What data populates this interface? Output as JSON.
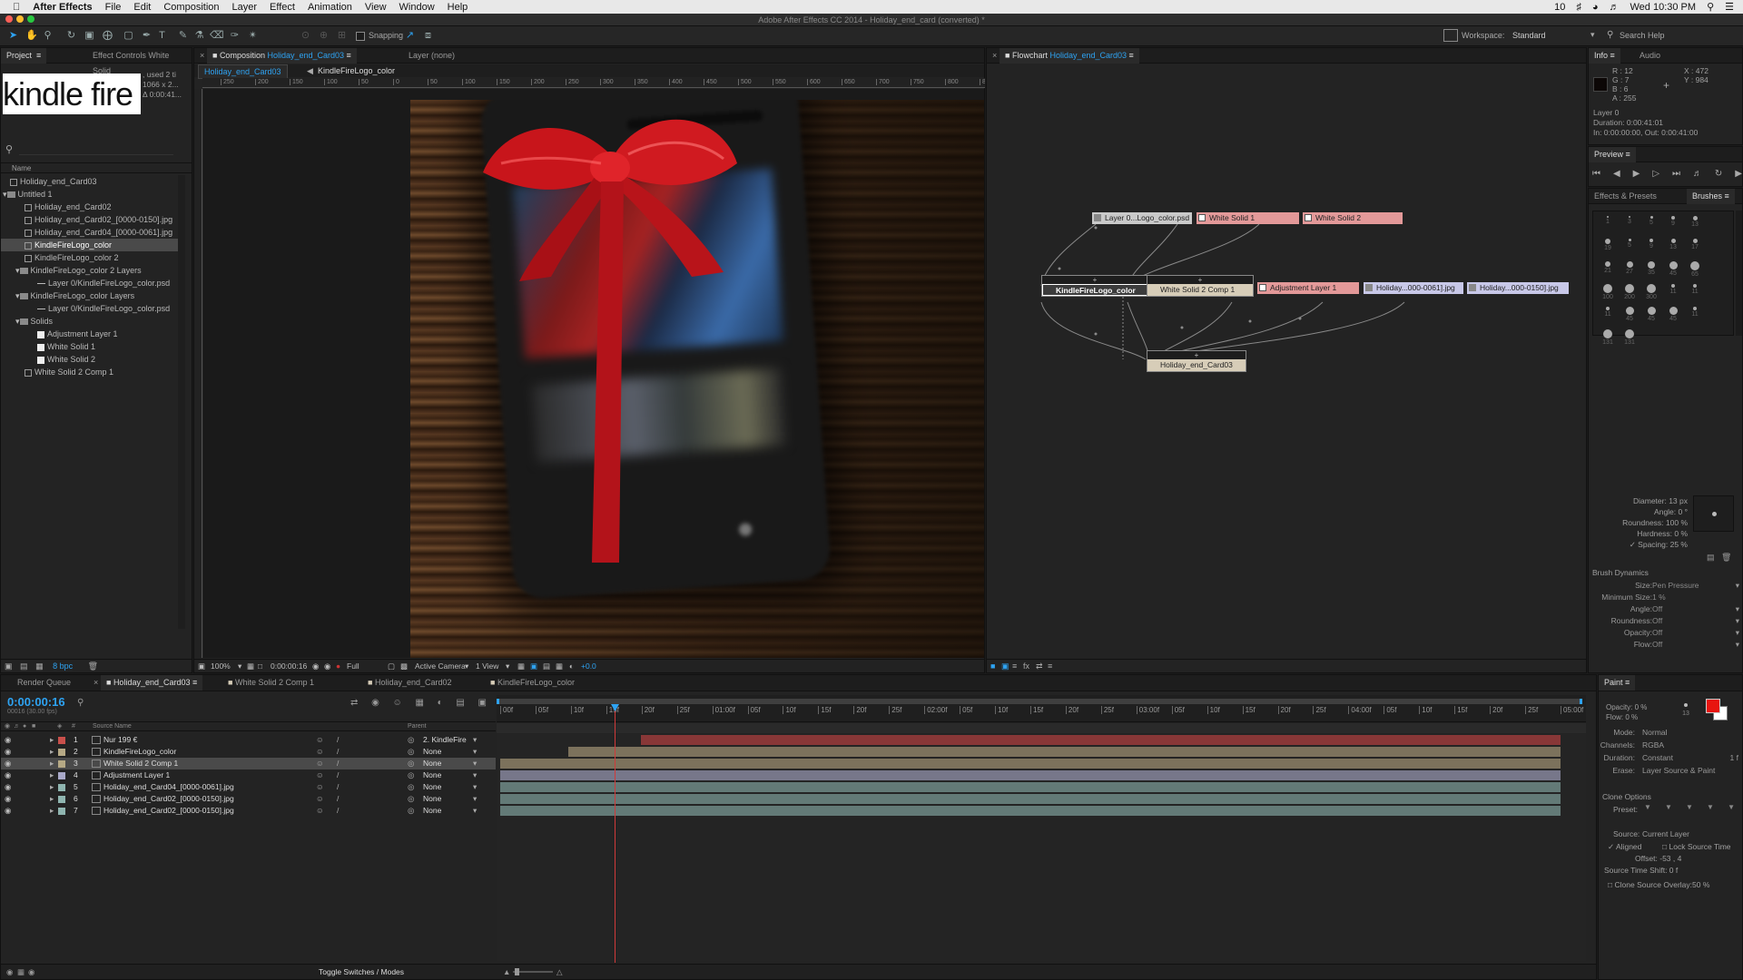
{
  "mac_menu": {
    "app": "After Effects",
    "items": [
      "File",
      "Edit",
      "Composition",
      "Layer",
      "Effect",
      "Animation",
      "View",
      "Window",
      "Help"
    ],
    "clock": "Wed 10:30 PM",
    "badge": "10"
  },
  "window_title": "Adobe After Effects CC 2014 - Holiday_end_card (converted) *",
  "toolbar": {
    "snapping": "Snapping",
    "workspace_label": "Workspace:",
    "workspace_value": "Standard",
    "search_help": "Search Help"
  },
  "project": {
    "tab_project": "Project",
    "tab_effect_controls": "Effect Controls White Solid",
    "thumbnail_text": "kindle fire",
    "thumb_info": [
      ", used 2 ti",
      "1066 x 2...",
      "Δ 0:00:41..."
    ],
    "col_name": "Name",
    "items": [
      {
        "label": "Holiday_end_Card03",
        "kind": "comp"
      },
      {
        "label": "Untitled 1",
        "kind": "folder"
      },
      {
        "label": "Holiday_end_Card02",
        "kind": "comp"
      },
      {
        "label": "Holiday_end_Card02_[0000-0150].jpg",
        "kind": "file"
      },
      {
        "label": "Holiday_end_Card04_[0000-0061].jpg",
        "kind": "file"
      },
      {
        "label": "KindleFireLogo_color",
        "kind": "comp"
      },
      {
        "label": "KindleFireLogo_color 2",
        "kind": "comp"
      },
      {
        "label": "KindleFireLogo_color 2 Layers",
        "kind": "folder"
      },
      {
        "label": "Layer 0/KindleFireLogo_color.psd",
        "kind": "file"
      },
      {
        "label": "KindleFireLogo_color Layers",
        "kind": "folder"
      },
      {
        "label": "Layer 0/KindleFireLogo_color.psd",
        "kind": "file"
      },
      {
        "label": "Solids",
        "kind": "folder"
      },
      {
        "label": "Adjustment Layer 1",
        "kind": "solid"
      },
      {
        "label": "White Solid 1",
        "kind": "solid"
      },
      {
        "label": "White Solid 2",
        "kind": "solid"
      },
      {
        "label": "White Solid 2 Comp 1",
        "kind": "comp"
      }
    ],
    "bpc": "8 bpc"
  },
  "composition": {
    "tab_label": "Composition",
    "tab_comp": "Holiday_end_Card03",
    "tab_layer": "Layer (none)",
    "sub_tab_1": "Holiday_end_Card03",
    "sub_tab_2": "KindleFireLogo_color",
    "ruler": [
      "250",
      "200",
      "150",
      "100",
      "50",
      "0",
      "50",
      "100",
      "150",
      "200",
      "250",
      "300",
      "350",
      "400",
      "450",
      "500",
      "550",
      "600",
      "650",
      "700",
      "750",
      "800",
      "85"
    ],
    "footer": {
      "zoom": "100%",
      "timecode": "0:00:00:16",
      "resolution": "Full",
      "camera": "Active Camera",
      "views": "1 View",
      "exposure": "+0.0"
    }
  },
  "flowchart": {
    "tab_label": "Flowchart",
    "tab_comp": "Holiday_end_Card03",
    "nodes": {
      "layer0": "Layer 0...Logo_color.psd",
      "ws1": "White Solid 1",
      "ws2": "White Solid 2",
      "kindle": "KindleFireLogo_color",
      "wsc": "White Solid 2 Comp 1",
      "adj": "Adjustment Layer 1",
      "h1": "Holiday...000-0061].jpg",
      "h2": "Holiday...000-0150].jpg",
      "out": "Holiday_end_Card03"
    }
  },
  "info": {
    "tab_info": "Info",
    "tab_audio": "Audio",
    "r": "R : 12",
    "g": "G : 7",
    "b": "B : 6",
    "a": "A : 255",
    "x": "X : 472",
    "y": "Y : 984",
    "layer": "Layer 0",
    "duration": "Duration: 0:00:41:01",
    "inout": "In: 0:00:00:00, Out: 0:00:41:00"
  },
  "preview": {
    "title": "Preview"
  },
  "brushes": {
    "tab_effects": "Effects & Presets",
    "tab_brushes": "Brushes",
    "sizes": [
      "1",
      "3",
      "5",
      "9",
      "13",
      "19",
      "5",
      "9",
      "13",
      "17",
      "21",
      "27",
      "35",
      "45",
      "65",
      "100",
      "200",
      "300",
      "11",
      "11",
      "11",
      "45",
      "45",
      "45",
      "11",
      "131",
      "131"
    ],
    "diameter": "Diameter: 13 px",
    "angle": "Angle: 0 °",
    "roundness": "Roundness: 100 %",
    "hardness": "Hardness: 0 %",
    "spacing": "Spacing: 25 %",
    "dynamics_title": "Brush Dynamics",
    "dynamics": [
      {
        "label": "Size:",
        "value": "Pen Pressure"
      },
      {
        "label": "Minimum Size:",
        "value": "1 %"
      },
      {
        "label": "Angle:",
        "value": "Off"
      },
      {
        "label": "Roundness:",
        "value": "Off"
      },
      {
        "label": "Opacity:",
        "value": "Off"
      },
      {
        "label": "Flow:",
        "value": "Off"
      }
    ]
  },
  "paint": {
    "title": "Paint",
    "opacity": "Opacity: 0 %",
    "flow": "Flow: 0 %",
    "brush_size": "13",
    "mode_label": "Mode:",
    "mode": "Normal",
    "channels_label": "Channels:",
    "channels": "RGBA",
    "duration_label": "Duration:",
    "duration": "Constant",
    "duration_frames": "1 f",
    "erase_label": "Erase:",
    "erase": "Layer Source & Paint",
    "clone_options": "Clone Options",
    "preset_label": "Preset:",
    "source_label": "Source:",
    "source": "Current Layer",
    "aligned": "Aligned",
    "lock_source": "Lock Source Time",
    "offset": "Offset: -53 ,     4",
    "source_time_shift": "Source Time Shift: 0 f",
    "clone_overlay": "Clone Source Overlay:",
    "clone_overlay_pct": "50 %",
    "fg_color": "#e8150f",
    "bg_color": "#ffffff"
  },
  "timeline": {
    "tabs": [
      "Render Queue",
      "Holiday_end_Card03",
      "White Solid 2 Comp 1",
      "Holiday_end_Card02",
      "KindleFireLogo_color"
    ],
    "timecode": "0:00:00:16",
    "fps": "00016 (30.00 fps)",
    "col_source": "Source Name",
    "col_parent": "Parent",
    "layers": [
      {
        "num": "1",
        "name": "Nur 199 €",
        "parent": "2. KindleFire",
        "color": "#c9504b"
      },
      {
        "num": "2",
        "name": "KindleFireLogo_color",
        "parent": "None",
        "color": "#b6a985"
      },
      {
        "num": "3",
        "name": "White Solid 2 Comp 1",
        "parent": "None",
        "color": "#b6a985"
      },
      {
        "num": "4",
        "name": "Adjustment Layer 1",
        "parent": "None",
        "color": "#a9a9c9"
      },
      {
        "num": "5",
        "name": "Holiday_end_Card04_[0000-0061].jpg",
        "parent": "None",
        "color": "#8fb5b0"
      },
      {
        "num": "6",
        "name": "Holiday_end_Card02_[0000-0150].jpg",
        "parent": "None",
        "color": "#8fb5b0"
      },
      {
        "num": "7",
        "name": "Holiday_end_Card02_[0000-0150].jpg",
        "parent": "None",
        "color": "#8fb5b0"
      }
    ],
    "ruler": [
      "00f",
      "05f",
      "10f",
      "15f",
      "20f",
      "25f",
      "01:00f",
      "05f",
      "10f",
      "15f",
      "20f",
      "25f",
      "02:00f",
      "05f",
      "10f",
      "15f",
      "20f",
      "25f",
      "03:00f",
      "05f",
      "10f",
      "15f",
      "20f",
      "25f",
      "04:00f",
      "05f",
      "10f",
      "15f",
      "20f",
      "25f",
      "05:00f"
    ],
    "toggle_label": "Toggle Switches / Modes"
  },
  "colors": {
    "accent_blue": "#2ea3f2",
    "playhead_red": "#d03a3a",
    "label_red": "#9a3b3b",
    "label_tan": "#8c8066",
    "label_lav": "#86869c",
    "label_teal": "#6f8a86"
  }
}
